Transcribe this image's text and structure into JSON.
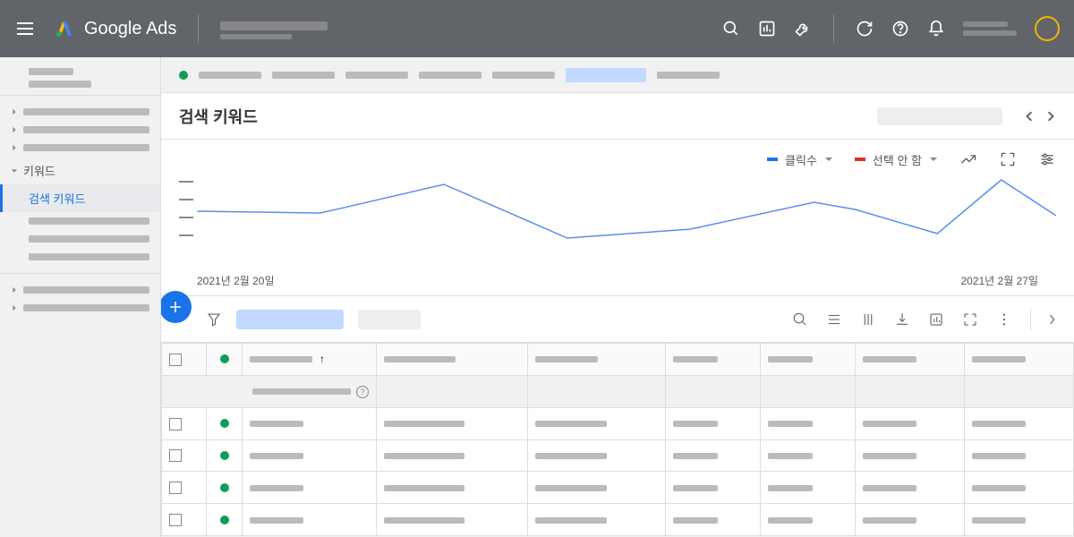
{
  "header": {
    "product_name": "Google Ads"
  },
  "sidebar": {
    "keywords_label": "키워드",
    "search_keywords_label": "검색 키워드"
  },
  "breadcrumb": {
    "status": "active"
  },
  "page": {
    "title": "검색 키워드"
  },
  "chart_controls": {
    "metric1": {
      "label": "클릭수",
      "color": "#1a73e8"
    },
    "metric2": {
      "label": "선택 안 함",
      "color": "#d93025"
    }
  },
  "chart_data": {
    "type": "line",
    "title": "",
    "xlabel": "",
    "ylabel": "",
    "x_start_label": "2021년 2월 20일",
    "x_end_label": "2021년 2월 27일",
    "x": [
      0,
      1,
      2,
      3,
      4,
      5,
      6,
      7
    ],
    "series": [
      {
        "name": "클릭수",
        "color": "#1a73e8",
        "values": [
          60,
          58,
          90,
          30,
          40,
          70,
          62,
          35
        ]
      }
    ],
    "y2_series_placeholder": [
      85,
      95,
      55,
      50,
      58
    ]
  },
  "table": {
    "columns": [
      "",
      "",
      "",
      "",
      "",
      "",
      "",
      ""
    ],
    "rows": 4
  }
}
